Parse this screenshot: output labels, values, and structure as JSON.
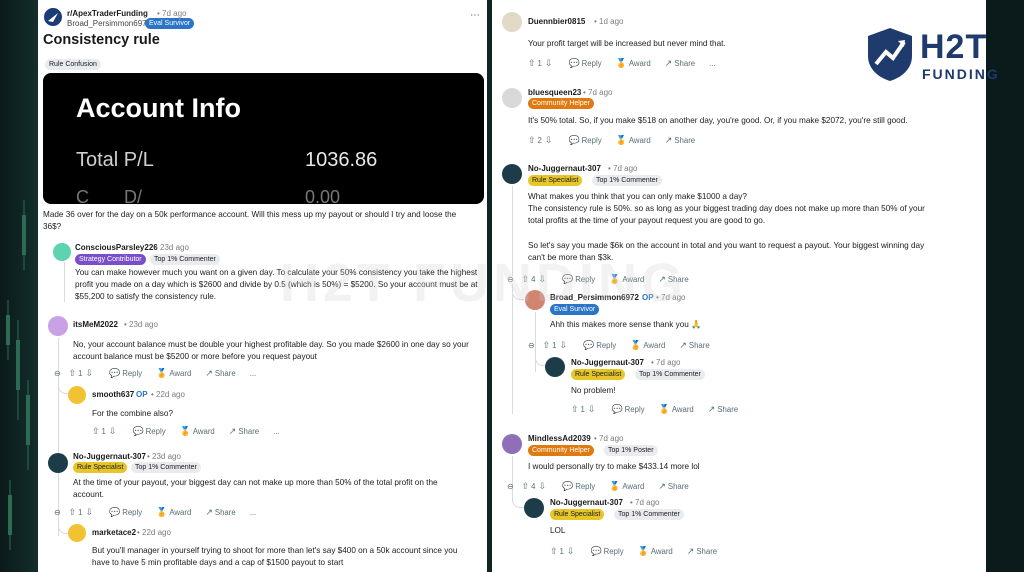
{
  "post": {
    "subreddit": "r/ApexTraderFunding",
    "time": "• 7d ago",
    "author": "Broad_Persimmon6972",
    "author_flair": "Eval Survivor",
    "title": "Consistency rule",
    "post_flair": "Rule Confusion",
    "image": {
      "heading": "Account Info",
      "label": "Total P/L",
      "value": "1036.86",
      "cut_label": "C___ D/_",
      "cut_value": "0.00"
    },
    "body_line1": "Made 36 over for the day on a 50k performance account. Will this mess up my payout or should I try and loose the",
    "body_line2": "36$?"
  },
  "left_comments": [
    {
      "user": "ConsciousParsley226",
      "time": "• 23d ago",
      "flair": "Strategy Contributor",
      "top": "Top 1% Commenter",
      "lines": [
        "You can make however much you want on a given day. To calculate your 50% consistency you take the highest",
        "profit you made on a day which is $2600 and divide by 0.5 (which is 50%) = $5200. So your account must be at",
        "$55,200 to satisfy the consistency rule."
      ]
    },
    {
      "user": "itsMeM2022",
      "time": "• 23d ago",
      "lines": [
        "No, your account balance must be double your highest profitable day. So you made $2600 in one day so your",
        "account balance must be $5200 or more before you request payout"
      ],
      "votes": "1",
      "reply": "Reply",
      "award": "Award",
      "share": "Share",
      "more": "..."
    },
    {
      "user": "smooth637",
      "op": "OP",
      "time": "• 22d ago",
      "lines": [
        "For the combine also?"
      ],
      "votes": "1",
      "reply": "Reply",
      "award": "Award",
      "share": "Share",
      "more": "..."
    },
    {
      "user": "No-Juggernaut-307",
      "time": "• 23d ago",
      "flair": "Rule Specialist",
      "top": "Top 1% Commenter",
      "lines": [
        "At the time of your payout, your biggest day can not make up more than 50% of the total profit on the",
        "account."
      ],
      "votes": "1",
      "reply": "Reply",
      "award": "Award",
      "share": "Share",
      "more": "..."
    },
    {
      "user": "marketace2",
      "time": "• 22d ago",
      "lines": [
        "But you'll manager in yourself trying to shoot for more than let's say $400 on a 50k account since you",
        "have to have 5 min profitable days and a cap of $1500 payout to start"
      ]
    }
  ],
  "right_comments": [
    {
      "user": "Duennbier0815",
      "time": "• 1d ago",
      "lines": [
        "Your profit target will be increased but never mind that."
      ],
      "votes": "1",
      "reply": "Reply",
      "award": "Award",
      "share": "Share",
      "more": "..."
    },
    {
      "user": "bluesqueen23",
      "time": "• 7d ago",
      "flair": "Community Helper",
      "lines": [
        "It's 50% total. So, if you make $518 on another day, you're good. Or, if you make $2072, you're still good."
      ],
      "votes": "2",
      "reply": "Reply",
      "award": "Award",
      "share": "Share"
    },
    {
      "user": "No-Juggernaut-307",
      "time": "• 7d ago",
      "flair": "Rule Specialist",
      "top": "Top 1% Commenter",
      "lines": [
        "What makes you think that you can only make $1000 a day?",
        "The consistency rule is 50%. so as long as your biggest trading day does not make up more than 50% of your",
        "total profits at the time of your payout request you are good to go.",
        "",
        "So let's say you made $6k on the account in total and you want to request a payout. Your biggest winning day",
        "can't be more than $3k."
      ],
      "votes": "4",
      "reply": "Reply",
      "award": "Award",
      "share": "Share"
    },
    {
      "user": "Broad_Persimmon6972",
      "op": "OP",
      "time": "• 7d ago",
      "flair": "Eval Survivor",
      "lines": [
        "Ahh this makes more sense thank you 🙏"
      ],
      "votes": "1",
      "reply": "Reply",
      "award": "Award",
      "share": "Share"
    },
    {
      "user": "No-Juggernaut-307",
      "time": "• 7d ago",
      "flair": "Rule Specialist",
      "top": "Top 1% Commenter",
      "lines": [
        "No problem!"
      ],
      "votes": "1",
      "reply": "Reply",
      "award": "Award",
      "share": "Share"
    },
    {
      "user": "MindlessAd2039",
      "time": "• 7d ago",
      "flair": "Community Helper",
      "top": "Top 1% Poster",
      "lines": [
        "I would personally try to make $433.14 more lol"
      ],
      "votes": "4",
      "reply": "Reply",
      "award": "Award",
      "share": "Share"
    },
    {
      "user": "No-Juggernaut-307",
      "time": "• 7d ago",
      "flair": "Rule Specialist",
      "top": "Top 1% Commenter",
      "lines": [
        "LOL"
      ],
      "votes": "1",
      "reply": "Reply",
      "award": "Award",
      "share": "Share"
    }
  ],
  "branding": {
    "logo_main": "H2T",
    "logo_sub": "FUNDING",
    "watermark": "H2T FUNDING"
  },
  "colors": {
    "strategy_flair": "#7a4ec9",
    "rule_flair": "#e6c628",
    "helper_flair": "#e07a10",
    "eval_flair": "#2b74c7",
    "logo_blue": "#1f3a6d"
  }
}
